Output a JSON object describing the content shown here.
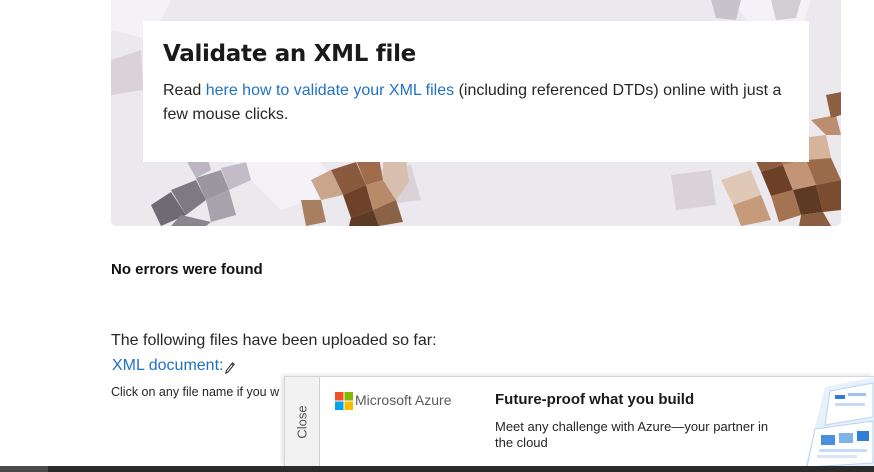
{
  "hero": {
    "title": "Validate an XML file",
    "text_before": "Read ",
    "link_text": "here how to validate your XML files",
    "text_after": " (including referenced DTDs) online with just a few mouse clicks."
  },
  "result": {
    "status": "No errors were found",
    "uploaded_label": "The following files have been uploaded so far:",
    "file_link": "XML document:",
    "hint": "Click on any file name if you w"
  },
  "ad": {
    "close_label": "Close",
    "brand": "Microsoft Azure",
    "headline": "Future-proof what you build",
    "body": "Meet any challenge with Azure—your partner in the cloud",
    "logo_colors": [
      "#f25022",
      "#7fba00",
      "#00a4ef",
      "#ffb900"
    ]
  },
  "icons": {
    "edit": "pencil-icon",
    "brand_logo": "microsoft-logo-icon"
  },
  "colors": {
    "link": "#1f72c4",
    "text": "#262626"
  }
}
